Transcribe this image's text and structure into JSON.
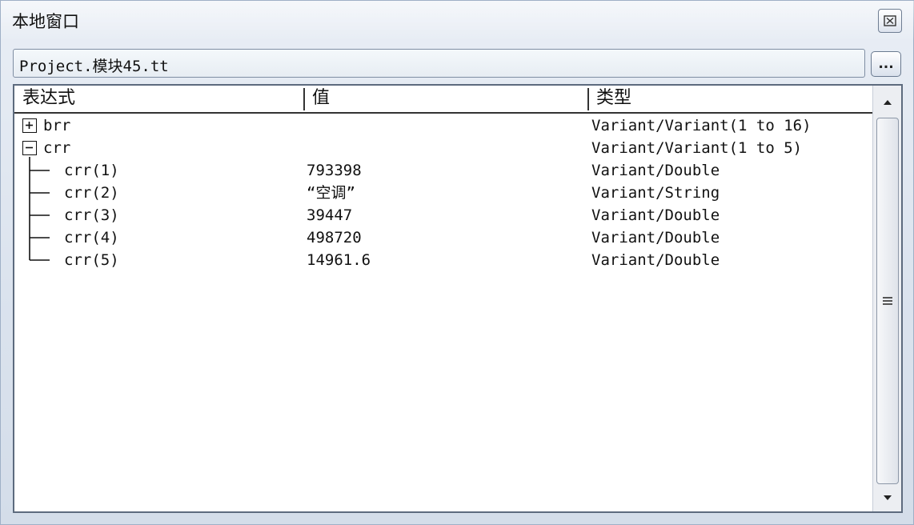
{
  "window": {
    "title": "本地窗口",
    "close_icon": "close-icon"
  },
  "context": {
    "path": "Project.模块45.tt",
    "browse_label": "..."
  },
  "columns": {
    "expression": "表达式",
    "value": "值",
    "type": "类型"
  },
  "rows": [
    {
      "expression": "brr",
      "value": "",
      "type": "Variant/Variant(1 to 16)",
      "expander": "+"
    },
    {
      "expression": "crr",
      "value": "",
      "type": "Variant/Variant(1 to 5)",
      "expander": "−"
    },
    {
      "expression": "crr(1)",
      "value": "793398",
      "type": "Variant/Double"
    },
    {
      "expression": "crr(2)",
      "value": "“空调”",
      "type": "Variant/String"
    },
    {
      "expression": "crr(3)",
      "value": "39447",
      "type": "Variant/Double"
    },
    {
      "expression": "crr(4)",
      "value": "498720",
      "type": "Variant/Double"
    },
    {
      "expression": "crr(5)",
      "value": "14961.6",
      "type": "Variant/Double"
    }
  ],
  "colors": {
    "window_bg": "#dfe7f1",
    "panel_border": "#5d6b7e",
    "text": "#111111"
  }
}
